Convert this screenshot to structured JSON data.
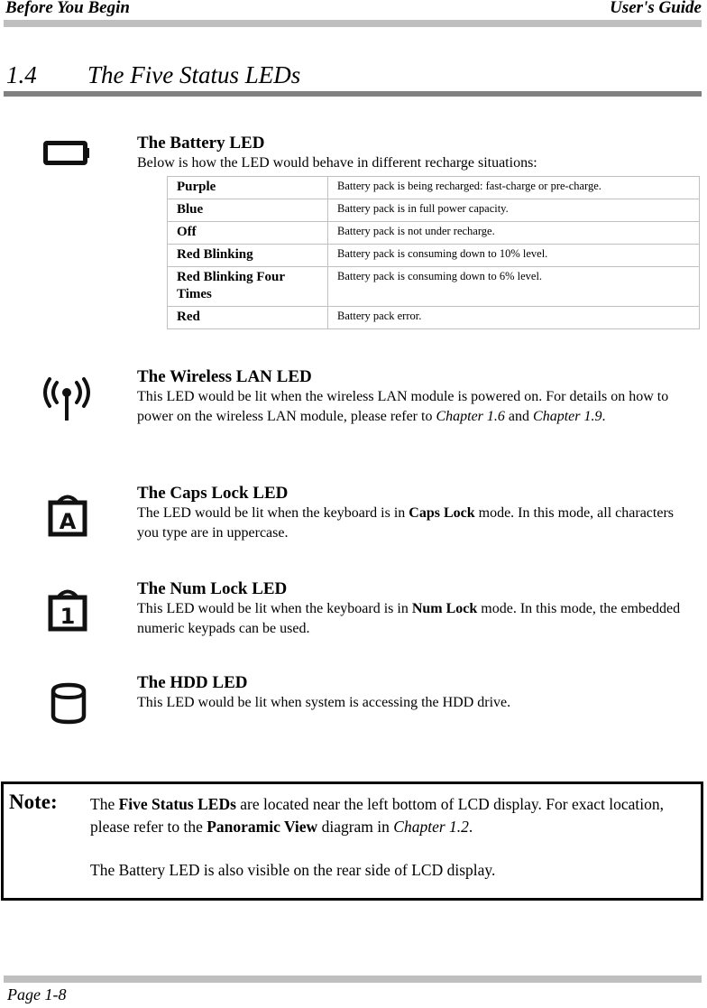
{
  "header": {
    "left": "Before You Begin",
    "right": "User's Guide"
  },
  "section": {
    "number": "1.4",
    "title": "The Five Status LEDs"
  },
  "battery": {
    "icon": "battery-icon",
    "title": "The Battery LED",
    "intro": "Below is how the LED would behave in different recharge situations:",
    "table": [
      {
        "state": "Purple",
        "description": "Battery pack is being recharged: fast-charge or pre-charge."
      },
      {
        "state": "Blue",
        "description": "Battery pack is in full power capacity."
      },
      {
        "state": "Off",
        "description": "Battery pack is not under recharge."
      },
      {
        "state": "Red Blinking",
        "description": "Battery pack is consuming down to 10% level."
      },
      {
        "state": "Red Blinking Four Times",
        "description": "Battery pack is consuming down to 6% level."
      },
      {
        "state": "Red",
        "description": "Battery pack error."
      }
    ]
  },
  "wireless": {
    "icon": "wireless-antenna-icon",
    "title": "The Wireless LAN LED",
    "text_1": "This LED would be lit when the wireless LAN module is powered on. For details on how to power on the wireless LAN module, please refer to ",
    "ref_1": "Chapter 1.6",
    "text_2": " and ",
    "ref_2": "Chapter 1.9",
    "text_3": "."
  },
  "capslock": {
    "icon": "caps-lock-icon",
    "icon_glyph": "A",
    "title": "The Caps Lock LED",
    "text_1": "The LED would be lit when the keyboard is in ",
    "bold": "Caps Lock",
    "text_2": " mode. In this mode, all characters you type are in uppercase."
  },
  "numlock": {
    "icon": "num-lock-icon",
    "icon_glyph": "1",
    "title": "The Num Lock LED",
    "text_1": "This LED would be lit when the keyboard is in ",
    "bold": "Num Lock",
    "text_2": " mode. In this mode, the embedded numeric keypads can be used."
  },
  "hdd": {
    "icon": "hdd-cylinder-icon",
    "title": "The HDD LED",
    "text": "This LED would be lit when system is accessing the HDD drive."
  },
  "note": {
    "label": "Note:",
    "p1_a": "The ",
    "p1_bold1": "Five Status LEDs",
    "p1_b": " are located near the left bottom of LCD display. For exact location, please refer to the ",
    "p1_bold2": "Panoramic View",
    "p1_c": " diagram in ",
    "p1_italic": "Chapter 1.2",
    "p1_d": ".",
    "p2": "The Battery LED is also visible on the rear side of LCD display."
  },
  "footer": {
    "page": "Page 1-8"
  },
  "colors": {
    "rule_light": "#bfbfbf",
    "rule_dark": "#808080",
    "table_border": "#c0c0c0"
  }
}
